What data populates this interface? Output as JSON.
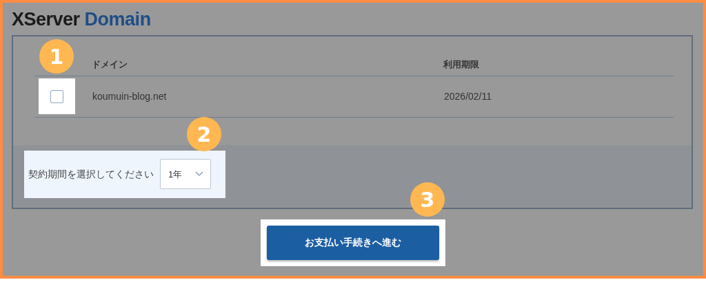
{
  "logo": {
    "brand": "XServer",
    "product": "Domain"
  },
  "callouts": [
    "1",
    "2",
    "3"
  ],
  "table": {
    "columns": [
      "ドメイン",
      "利用期限"
    ],
    "rows": [
      {
        "checked": false,
        "highlighted": true,
        "domain": "koumuin-blog.net",
        "expiry": "2026/02/11"
      }
    ]
  },
  "period": {
    "label": "契約期間を選択してください",
    "value": "1年",
    "highlighted": true
  },
  "submit": {
    "label": "お支払い手続きへ進む",
    "highlighted": true
  }
}
